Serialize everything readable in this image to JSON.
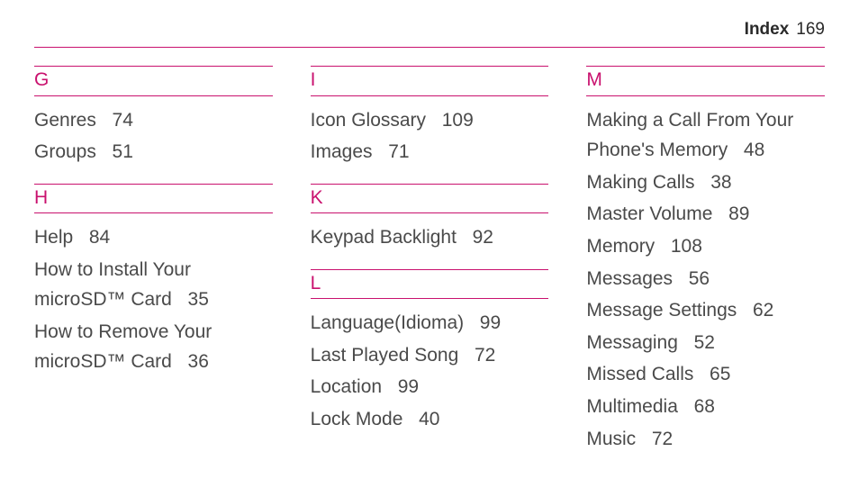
{
  "header": {
    "title": "Index",
    "page": "169"
  },
  "columns": [
    {
      "sections": [
        {
          "letter": "G",
          "entries": [
            {
              "label": "Genres",
              "page": "74"
            },
            {
              "label": "Groups",
              "page": "51"
            }
          ]
        },
        {
          "letter": "H",
          "entries": [
            {
              "label": "Help",
              "page": "84"
            },
            {
              "label": "How to Install Your microSD™ Card",
              "page": "35"
            },
            {
              "label": "How to Remove Your microSD™ Card",
              "page": "36"
            }
          ]
        }
      ]
    },
    {
      "sections": [
        {
          "letter": "I",
          "entries": [
            {
              "label": "Icon Glossary",
              "page": "109"
            },
            {
              "label": "Images",
              "page": "71"
            }
          ]
        },
        {
          "letter": "K",
          "entries": [
            {
              "label": "Keypad Backlight",
              "page": "92"
            }
          ]
        },
        {
          "letter": "L",
          "entries": [
            {
              "label": "Language(Idioma)",
              "page": "99"
            },
            {
              "label": "Last Played Song",
              "page": "72"
            },
            {
              "label": "Location",
              "page": "99"
            },
            {
              "label": "Lock Mode",
              "page": "40"
            }
          ]
        }
      ]
    },
    {
      "sections": [
        {
          "letter": "M",
          "entries": [
            {
              "label": "Making a Call From Your Phone's Memory",
              "page": "48"
            },
            {
              "label": "Making Calls",
              "page": "38"
            },
            {
              "label": "Master Volume",
              "page": "89"
            },
            {
              "label": "Memory",
              "page": "108"
            },
            {
              "label": "Messages",
              "page": "56"
            },
            {
              "label": "Message Settings",
              "page": "62"
            },
            {
              "label": "Messaging",
              "page": "52"
            },
            {
              "label": "Missed Calls",
              "page": "65"
            },
            {
              "label": "Multimedia",
              "page": "68"
            },
            {
              "label": "Music",
              "page": "72"
            }
          ]
        }
      ]
    }
  ]
}
